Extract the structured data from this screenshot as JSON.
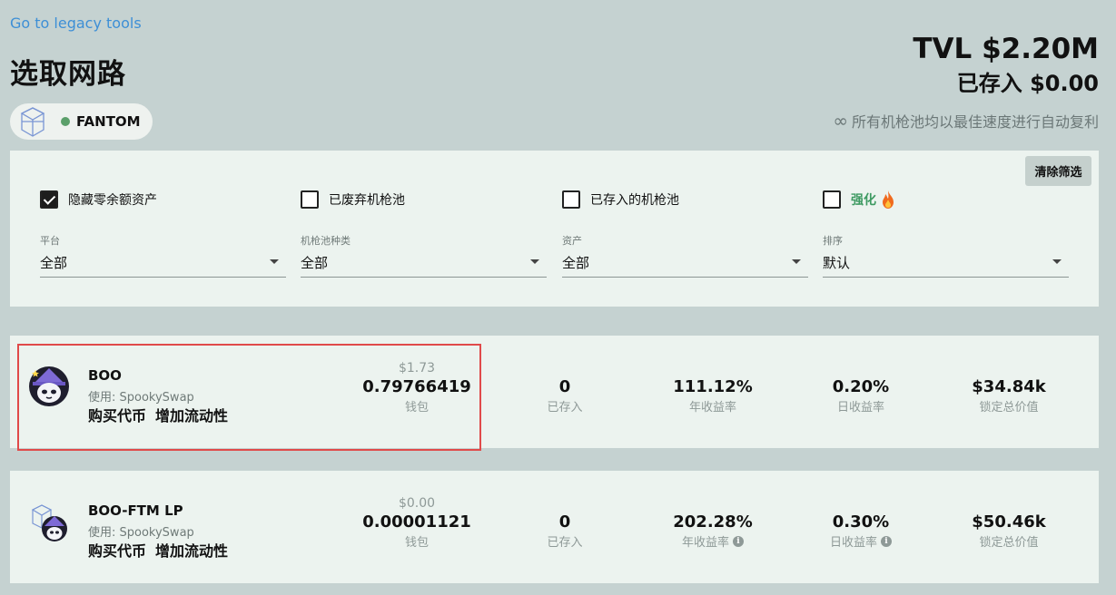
{
  "header": {
    "legacy_link": "Go to legacy tools",
    "title": "选取网路",
    "tvl": "TVL $2.20M",
    "deposited": "已存入 $0.00",
    "autocompound_icon": "infinity-icon",
    "autocompound_text": "所有机枪池均以最佳速度进行自动复利"
  },
  "network": {
    "label": "FANTOM",
    "icon": "fantom-logo-icon",
    "status_color": "#5a9f6a"
  },
  "filters": {
    "clear_label": "清除筛选",
    "checkboxes": [
      {
        "label": "隐藏零余额资产",
        "checked": true
      },
      {
        "label": "已废弃机枪池",
        "checked": false
      },
      {
        "label": "已存入的机枪池",
        "checked": false
      },
      {
        "label": "强化",
        "checked": false,
        "icon": "fire-icon"
      }
    ],
    "selects": [
      {
        "label": "平台",
        "value": "全部"
      },
      {
        "label": "机枪池种类",
        "value": "全部"
      },
      {
        "label": "资产",
        "value": "全部"
      },
      {
        "label": "排序",
        "value": "默认"
      }
    ]
  },
  "vaults": [
    {
      "name": "BOO",
      "platform": "使用: SpookySwap",
      "logo": "boo-token-icon",
      "actions": [
        "购买代币",
        "增加流动性"
      ],
      "wallet_usd": "$1.73",
      "wallet_amount": "0.79766419",
      "wallet_label": "钱包",
      "deposited_value": "0",
      "deposited_label": "已存入",
      "apy_value": "111.12%",
      "apy_label": "年收益率",
      "daily_value": "0.20%",
      "daily_label": "日收益率",
      "tvl_value": "$34.84k",
      "tvl_label": "锁定总价值"
    },
    {
      "name": "BOO-FTM LP",
      "platform": "使用: SpookySwap",
      "logo": "boo-ftm-lp-icon",
      "actions": [
        "购买代币",
        "增加流动性"
      ],
      "wallet_usd": "$0.00",
      "wallet_amount": "0.00001121",
      "wallet_label": "钱包",
      "deposited_value": "0",
      "deposited_label": "已存入",
      "apy_value": "202.28%",
      "apy_label": "年收益率",
      "daily_value": "0.30%",
      "daily_label": "日收益率",
      "tvl_value": "$50.46k",
      "tvl_label": "锁定总价值"
    }
  ],
  "colors": {
    "background": "#c5d2d1",
    "panel": "#ecf3ef",
    "link": "#3d8fd6",
    "highlight": "#e04a4a",
    "boost": "#3e9a62"
  }
}
